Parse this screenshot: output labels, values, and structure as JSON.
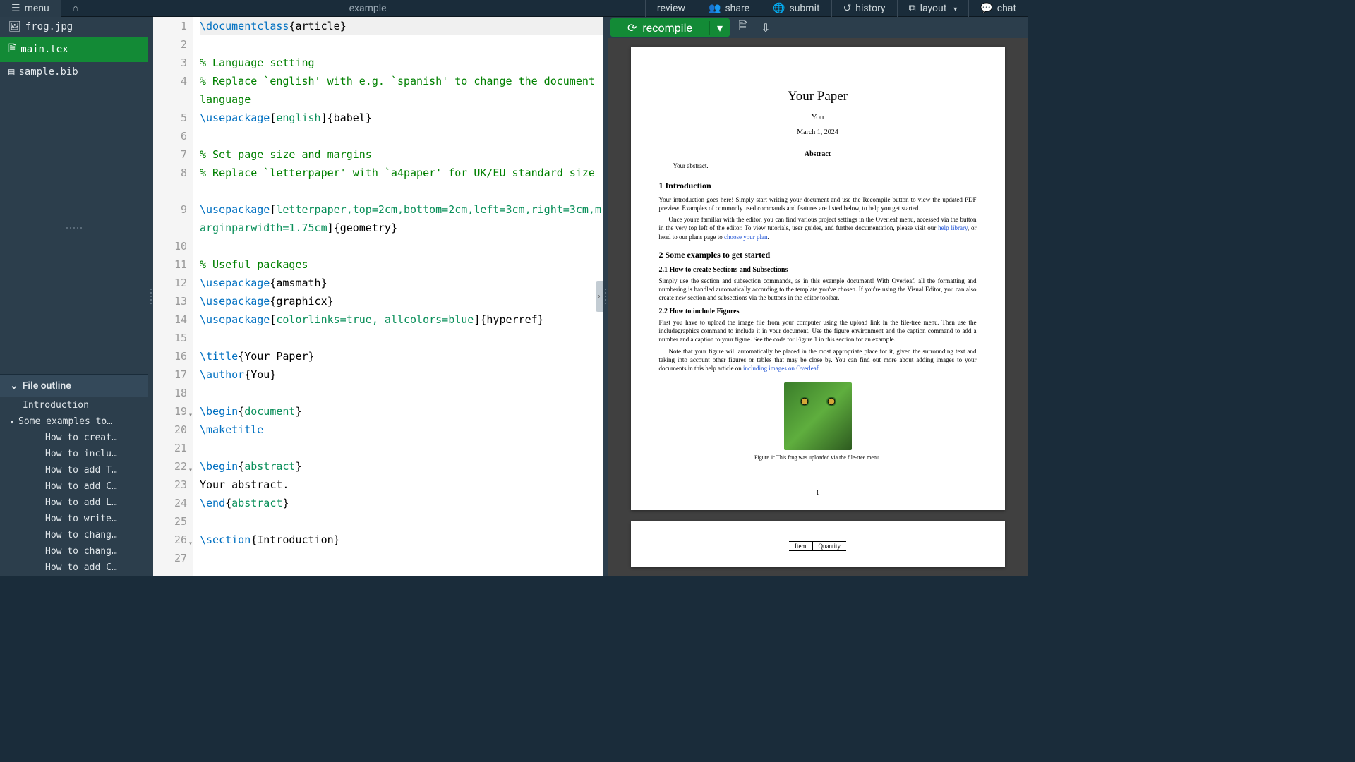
{
  "topbar": {
    "menu": "menu",
    "project_name": "example",
    "review": "review",
    "share": "share",
    "submit": "submit",
    "history": "history",
    "layout": "layout",
    "chat": "chat"
  },
  "files": [
    {
      "name": "frog.jpg",
      "icon": "image",
      "selected": false
    },
    {
      "name": "main.tex",
      "icon": "file",
      "selected": true
    },
    {
      "name": "sample.bib",
      "icon": "book",
      "selected": false
    }
  ],
  "outline": {
    "header": "File outline",
    "items": [
      {
        "label": "Introduction",
        "level": 0
      },
      {
        "label": "Some examples to…",
        "level": 0,
        "has_children": true
      },
      {
        "label": "How to creat…",
        "level": 2
      },
      {
        "label": "How to inclu…",
        "level": 2
      },
      {
        "label": "How to add T…",
        "level": 2
      },
      {
        "label": "How to add C…",
        "level": 2
      },
      {
        "label": "How to add L…",
        "level": 2
      },
      {
        "label": "How to write…",
        "level": 2
      },
      {
        "label": "How to chang…",
        "level": 2
      },
      {
        "label": "How to chang…",
        "level": 2
      },
      {
        "label": "How to add C…",
        "level": 2
      }
    ]
  },
  "editor": {
    "lines": [
      {
        "n": 1,
        "highlight": true,
        "segs": [
          [
            "cmd",
            "\\documentclass"
          ],
          [
            "p",
            "{"
          ],
          [
            "t",
            "article"
          ],
          [
            "p",
            "}"
          ]
        ]
      },
      {
        "n": 2,
        "segs": []
      },
      {
        "n": 3,
        "segs": [
          [
            "comment",
            "% Language setting"
          ]
        ]
      },
      {
        "n": 4,
        "wrap": 2,
        "segs": [
          [
            "comment",
            "% Replace `english' with e.g. `spanish' to change the document language"
          ]
        ]
      },
      {
        "n": 5,
        "segs": [
          [
            "cmd",
            "\\usepackage"
          ],
          [
            "p",
            "["
          ],
          [
            "arg",
            "english"
          ],
          [
            "p",
            "]{"
          ],
          [
            "t",
            "babel"
          ],
          [
            "p",
            "}"
          ]
        ]
      },
      {
        "n": 6,
        "segs": []
      },
      {
        "n": 7,
        "segs": [
          [
            "comment",
            "% Set page size and margins"
          ]
        ]
      },
      {
        "n": 8,
        "wrap": 2,
        "segs": [
          [
            "comment",
            "% Replace `letterpaper' with `a4paper' for UK/EU standard size"
          ]
        ]
      },
      {
        "n": 9,
        "wrap": 2,
        "segs": [
          [
            "cmd",
            "\\usepackage"
          ],
          [
            "p",
            "["
          ],
          [
            "arg",
            "letterpaper,top=2cm,bottom=2cm,left=3cm,right=3cm,marginparwidth=1.75cm"
          ],
          [
            "p",
            "]{"
          ],
          [
            "t",
            "geometry"
          ],
          [
            "p",
            "}"
          ]
        ]
      },
      {
        "n": 10,
        "segs": []
      },
      {
        "n": 11,
        "segs": [
          [
            "comment",
            "% Useful packages"
          ]
        ]
      },
      {
        "n": 12,
        "segs": [
          [
            "cmd",
            "\\usepackage"
          ],
          [
            "p",
            "{"
          ],
          [
            "t",
            "amsmath"
          ],
          [
            "p",
            "}"
          ]
        ]
      },
      {
        "n": 13,
        "segs": [
          [
            "cmd",
            "\\usepackage"
          ],
          [
            "p",
            "{"
          ],
          [
            "t",
            "graphicx"
          ],
          [
            "p",
            "}"
          ]
        ]
      },
      {
        "n": 14,
        "segs": [
          [
            "cmd",
            "\\usepackage"
          ],
          [
            "p",
            "["
          ],
          [
            "arg",
            "colorlinks=true, allcolors=blue"
          ],
          [
            "p",
            "]{"
          ],
          [
            "t",
            "hyperref"
          ],
          [
            "p",
            "}"
          ]
        ]
      },
      {
        "n": 15,
        "segs": []
      },
      {
        "n": 16,
        "segs": [
          [
            "cmd",
            "\\title"
          ],
          [
            "p",
            "{"
          ],
          [
            "t",
            "Your Paper"
          ],
          [
            "p",
            "}"
          ]
        ]
      },
      {
        "n": 17,
        "segs": [
          [
            "cmd",
            "\\author"
          ],
          [
            "p",
            "{"
          ],
          [
            "t",
            "You"
          ],
          [
            "p",
            "}"
          ]
        ]
      },
      {
        "n": 18,
        "segs": []
      },
      {
        "n": 19,
        "fold": true,
        "segs": [
          [
            "cmd",
            "\\begin"
          ],
          [
            "p",
            "{"
          ],
          [
            "arg",
            "document"
          ],
          [
            "p",
            "}"
          ]
        ]
      },
      {
        "n": 20,
        "segs": [
          [
            "cmd",
            "\\maketitle"
          ]
        ]
      },
      {
        "n": 21,
        "segs": []
      },
      {
        "n": 22,
        "fold": true,
        "segs": [
          [
            "cmd",
            "\\begin"
          ],
          [
            "p",
            "{"
          ],
          [
            "arg",
            "abstract"
          ],
          [
            "p",
            "}"
          ]
        ]
      },
      {
        "n": 23,
        "segs": [
          [
            "t",
            "Your abstract."
          ]
        ]
      },
      {
        "n": 24,
        "segs": [
          [
            "cmd",
            "\\end"
          ],
          [
            "p",
            "{"
          ],
          [
            "arg",
            "abstract"
          ],
          [
            "p",
            "}"
          ]
        ]
      },
      {
        "n": 25,
        "segs": []
      },
      {
        "n": 26,
        "fold": true,
        "segs": [
          [
            "cmd",
            "\\section"
          ],
          [
            "p",
            "{"
          ],
          [
            "t",
            "Introduction"
          ],
          [
            "p",
            "}"
          ]
        ]
      },
      {
        "n": 27,
        "segs": []
      }
    ]
  },
  "recompile": "recompile",
  "pdf": {
    "title": "Your Paper",
    "author": "You",
    "date": "March 1, 2024",
    "abstract_h": "Abstract",
    "abstract": "Your abstract.",
    "sec1_h": "1   Introduction",
    "sec1_p1": "Your introduction goes here! Simply start writing your document and use the Recompile button to view the updated PDF preview. Examples of commonly used commands and features are listed below, to help you get started.",
    "sec1_p2a": "Once you're familiar with the editor, you can find various project settings in the Overleaf menu, accessed via the button in the very top left of the editor. To view tutorials, user guides, and further documentation, please visit our ",
    "sec1_p2_link1": "help library",
    "sec1_p2b": ", or head to our plans page to ",
    "sec1_p2_link2": "choose your plan",
    "sec1_p2c": ".",
    "sec2_h": "2   Some examples to get started",
    "sec21_h": "2.1   How to create Sections and Subsections",
    "sec21_p": "Simply use the section and subsection commands, as in this example document! With Overleaf, all the formatting and numbering is handled automatically according to the template you've chosen. If you're using the Visual Editor, you can also create new section and subsections via the buttons in the editor toolbar.",
    "sec22_h": "2.2   How to include Figures",
    "sec22_p1": "First you have to upload the image file from your computer using the upload link in the file-tree menu. Then use the includegraphics command to include it in your document. Use the figure environment and the caption command to add a number and a caption to your figure. See the code for Figure 1 in this section for an example.",
    "sec22_p2a": "Note that your figure will automatically be placed in the most appropriate place for it, given the surrounding text and taking into account other figures or tables that may be close by. You can find out more about adding images to your documents in this help article on ",
    "sec22_p2_link": "including images on Overleaf",
    "sec22_p2b": ".",
    "fig_caption": "Figure 1: This frog was uploaded via the file-tree menu.",
    "pagenum": "1",
    "table_headers": [
      "Item",
      "Quantity"
    ]
  }
}
